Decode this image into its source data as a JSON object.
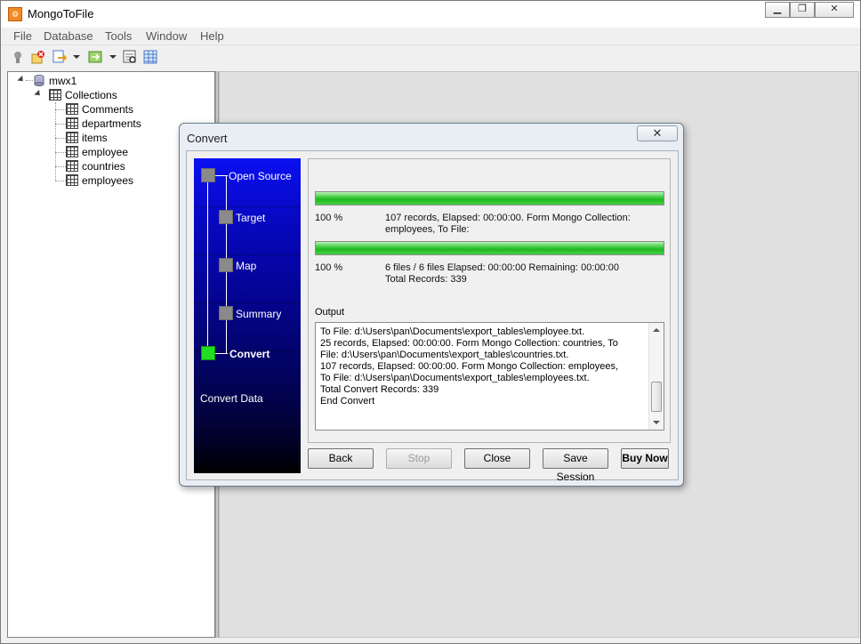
{
  "window": {
    "title": "MongoToFile",
    "icon": "app-logo-icon",
    "controls": [
      "minimize-icon",
      "maximize-icon",
      "close-icon"
    ]
  },
  "menu": [
    "File",
    "Database",
    "Tools",
    "Window",
    "Help"
  ],
  "toolbar": [
    "connect-icon",
    "disconnect-icon",
    "export-icon",
    "dropdown-arrow-icon",
    "refresh-icon",
    "dropdown-arrow-icon",
    "query-icon",
    "table-view-icon"
  ],
  "tree": {
    "connection": "mwx1",
    "folder": "Collections",
    "collections": [
      "Comments",
      "departments",
      "items",
      "employee",
      "countries",
      "employees"
    ]
  },
  "dialog": {
    "title": "Convert",
    "close_glyph": "✕",
    "steps": [
      {
        "label": "Open Source",
        "active": false
      },
      {
        "label": "Target",
        "active": false
      },
      {
        "label": "Map",
        "active": false
      },
      {
        "label": "Summary",
        "active": false
      },
      {
        "label": "Convert",
        "active": true
      }
    ],
    "footer_label": "Convert Data",
    "progress1": {
      "value": 1.0,
      "percent": "100 %",
      "info_line1": "107 records,    Elapsed: 00:00:00.    Form Mongo Collection:",
      "info_line2": "employees,    To File:"
    },
    "progress2": {
      "value": 1.0,
      "percent": "100 %",
      "info_line1": "6 files / 6 files    Elapsed: 00:00:00    Remaining: 00:00:00",
      "info_line2": "Total Records: 339"
    },
    "output_label": "Output",
    "output_lines": [
      "To File: d:\\Users\\pan\\Documents\\export_tables\\employee.txt.",
      "25 records,    Elapsed: 00:00:00.    Form Mongo Collection: countries,    To",
      "File: d:\\Users\\pan\\Documents\\export_tables\\countries.txt.",
      "107 records,    Elapsed: 00:00:00.    Form Mongo Collection: employees,",
      "To File: d:\\Users\\pan\\Documents\\export_tables\\employees.txt.",
      "Total Convert Records: 339",
      "End Convert"
    ],
    "buttons": {
      "back": "Back",
      "stop": "Stop",
      "close": "Close",
      "save_session": "Save Session",
      "buy_now": "Buy Now"
    }
  },
  "colors": {
    "progress_fill": "#1fb81f",
    "steps_top": "#0a10f0",
    "active_step": "#22dd22"
  }
}
